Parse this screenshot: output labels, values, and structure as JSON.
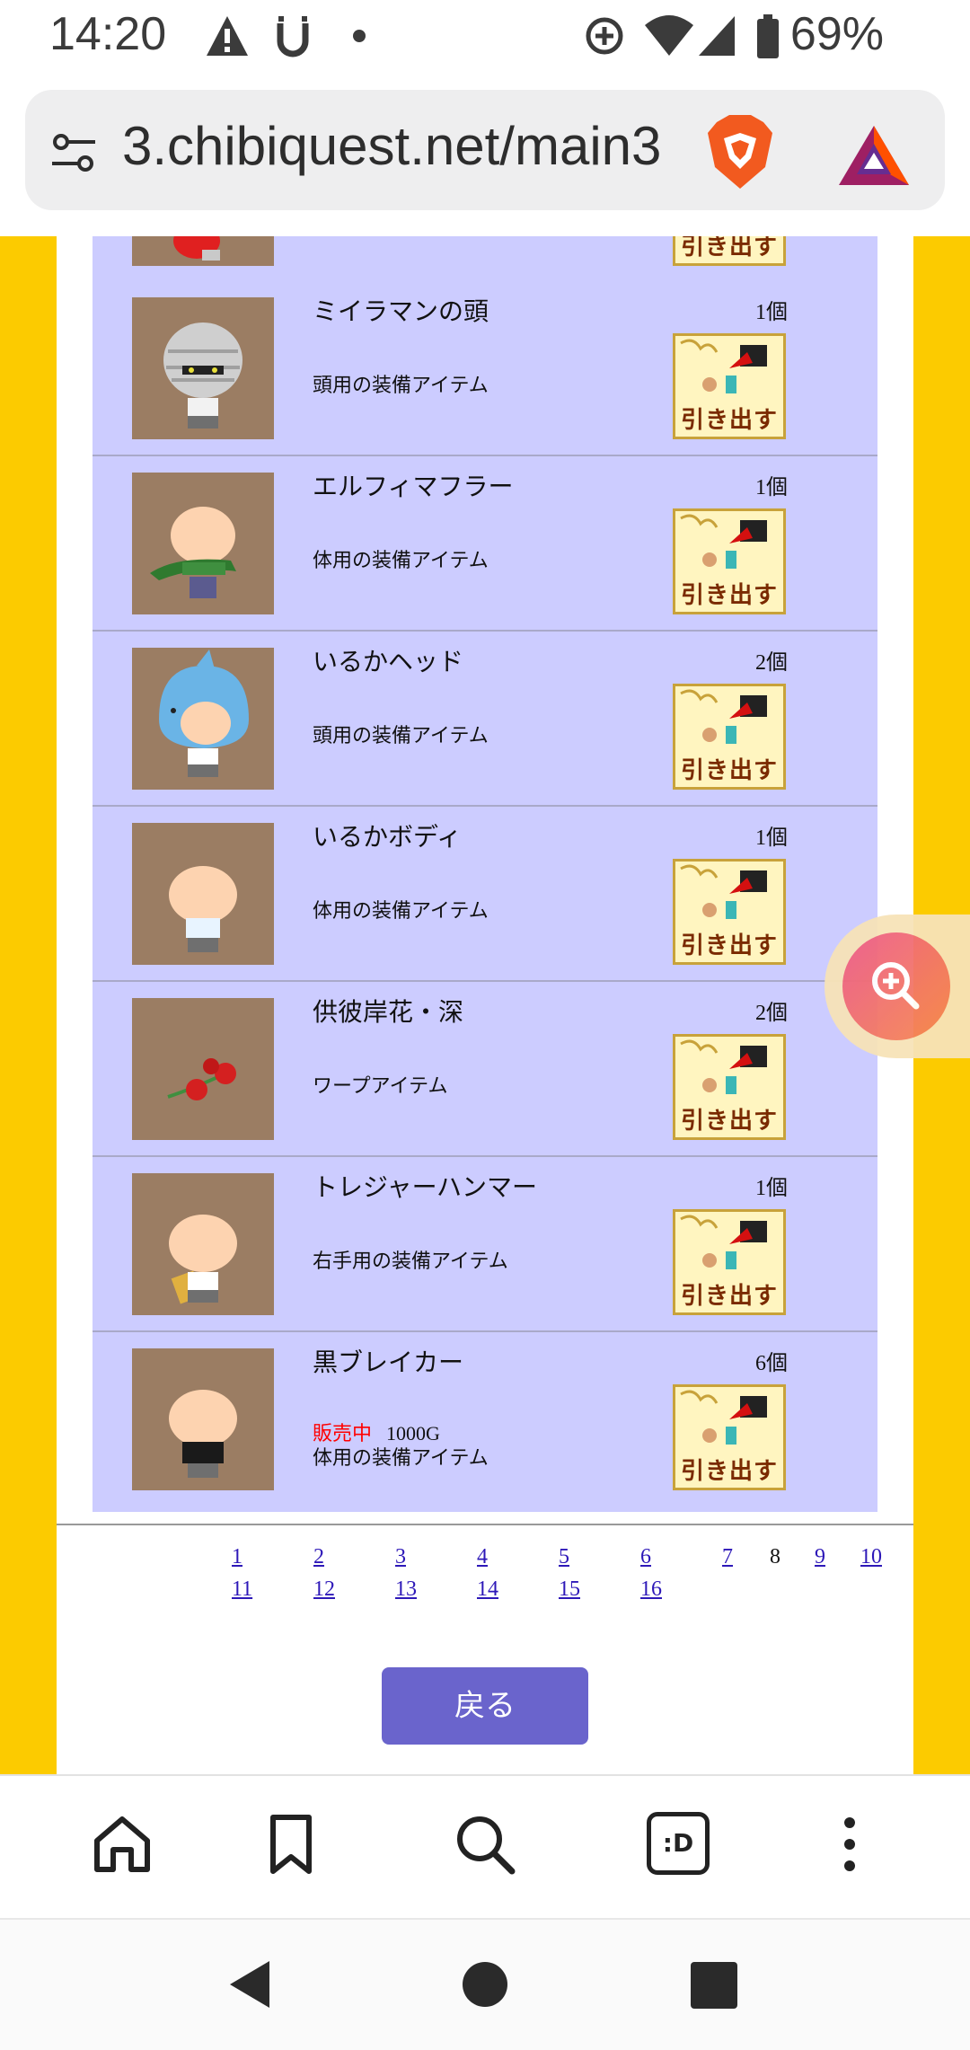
{
  "status_bar": {
    "time": "14:20",
    "battery": "69%",
    "icons": [
      "warning-icon",
      "u-app-icon",
      "dot-icon",
      "data-saver-icon",
      "wifi-icon",
      "signal-icon",
      "battery-icon"
    ]
  },
  "browser": {
    "url": "3.chibiquest.net/main3",
    "icons": [
      "tune-icon",
      "brave-shield-icon",
      "bat-rewards-icon"
    ]
  },
  "items": [
    {
      "name": "",
      "count": "",
      "desc": "",
      "button": "引き出す"
    },
    {
      "name": "ミイラマンの頭",
      "count": "1個",
      "desc": "頭用の装備アイテム",
      "button": "引き出す"
    },
    {
      "name": "エルフィマフラー",
      "count": "1個",
      "desc": "体用の装備アイテム",
      "button": "引き出す"
    },
    {
      "name": "いるかヘッド",
      "count": "2個",
      "desc": "頭用の装備アイテム",
      "button": "引き出す"
    },
    {
      "name": "いるかボディ",
      "count": "1個",
      "desc": "体用の装備アイテム",
      "button": "引き出す"
    },
    {
      "name": "供彼岸花・深",
      "count": "2個",
      "desc": "ワープアイテム",
      "button": "引き出す"
    },
    {
      "name": "トレジャーハンマー",
      "count": "1個",
      "desc": "右手用の装備アイテム",
      "button": "引き出す"
    },
    {
      "name": "黒ブレイカー",
      "count": "6個",
      "sale_label": "販売中",
      "sale_price": "1000G",
      "desc": "体用の装備アイテム",
      "button": "引き出す"
    }
  ],
  "pagination": {
    "pages": [
      "1",
      "2",
      "3",
      "4",
      "5",
      "6",
      "7",
      "8",
      "9",
      "10",
      "11",
      "12",
      "13",
      "14",
      "15",
      "16"
    ],
    "current": "8"
  },
  "back_button": "戻る",
  "nav": {
    "icons": [
      "home-icon",
      "bookmark-icon",
      "search-icon",
      "tabs-icon",
      "more-icon"
    ],
    "tabs_label": ":D"
  },
  "colors": {
    "page_bg": "#fccb00",
    "item_bg": "#ccccff",
    "back_button": "#6a64cc",
    "sale_text": "#ff0000"
  }
}
